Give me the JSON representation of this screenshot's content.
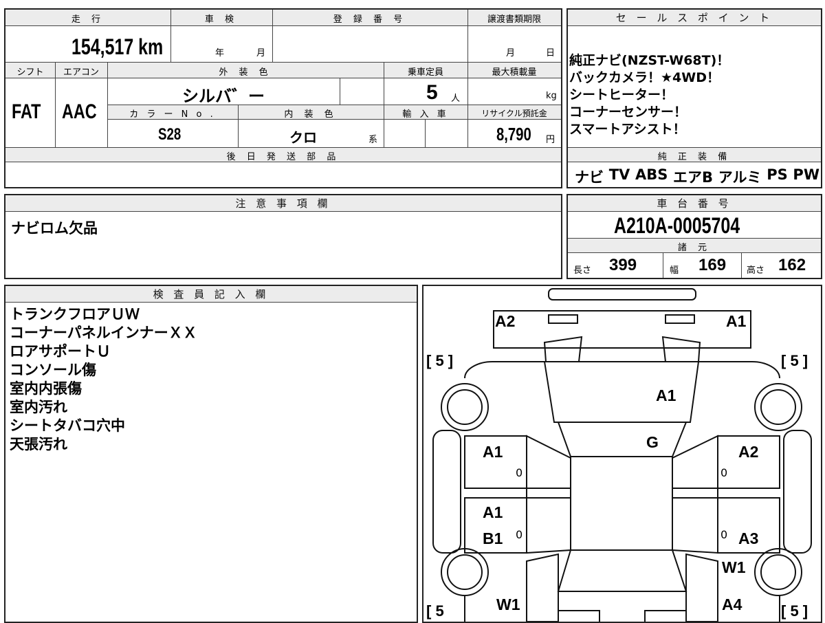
{
  "vehicle": {
    "mileage_header": "走 行",
    "mileage_value": "154,517",
    "mileage_unit": "km",
    "inspection_header": "車 検",
    "inspection_year": "年",
    "inspection_month": "月",
    "registration_header": "登 録 番 号",
    "transfer_deadline_header": "譲渡書類期限",
    "transfer_month": "月",
    "transfer_day": "日",
    "shift_header": "シフト",
    "shift_value": "FAT",
    "aircon_header": "エアコン",
    "aircon_value": "AAC",
    "exterior_color_header": "外 装 色",
    "exterior_color_value": "シルバ゛ー",
    "capacity_header": "乗車定員",
    "capacity_value": "5",
    "capacity_unit": "人",
    "max_load_header": "最大積載量",
    "max_load_unit": "kg",
    "color_no_header": "カ ラ ー N o .",
    "color_no_value": "S28",
    "interior_color_header": "内 装 色",
    "interior_color_value": "クロ",
    "interior_color_suffix": "系",
    "import_header": "輸 入 車",
    "recycle_header": "リサイクル預託金",
    "recycle_value": "8,790",
    "recycle_unit": "円",
    "later_parts_header": "後 日 発 送 部 品"
  },
  "sales_points": {
    "header": "セ ー ル ス ポ イ ン ト",
    "lines": [
      "純正ナビ(NZST-W68T)！",
      "バックカメラ！★4WD！",
      "シートヒーター！",
      "コーナーセンサー！",
      "スマートアシスト！"
    ]
  },
  "equipment": {
    "header": "純 正 装 備",
    "items": [
      "ナビ",
      "TV",
      "ABS",
      "エアB",
      "アルミ",
      "PS",
      "PW"
    ]
  },
  "notes": {
    "header": "注 意 事 項 欄",
    "text": "ナビロム欠品"
  },
  "chassis": {
    "header": "車 台 番 号",
    "value": "A210A-0005704"
  },
  "specs": {
    "header": "諸 元",
    "length_label": "長さ",
    "length_value": "399",
    "width_label": "幅",
    "width_value": "169",
    "height_label": "高さ",
    "height_value": "162"
  },
  "inspector": {
    "header": "検 査 員 記 入 欄",
    "lines": [
      "トランクフロアＵＷ",
      "コーナーパネルインナーＸＸ",
      "ロアサポートＵ",
      "コンソール傷",
      "室内内張傷",
      "室内汚れ",
      "シートタバコ穴中",
      "天張汚れ"
    ]
  },
  "diagram": {
    "tire_top_left": "[ 5 ]",
    "tire_top_right": "[ 5 ]",
    "tire_bottom_left": "[ 5",
    "tire_bottom_right": "[ 5 ]",
    "grades": {
      "rear_left": "A2",
      "rear_right": "A1",
      "trunk": "A1",
      "roof": "G",
      "left_rear_door": "A1",
      "left_front_door": "A1",
      "left_sill": "B1",
      "left_front_fender": "W1",
      "right_rear_door": "A2",
      "right_sill": "A3",
      "right_front_door": "W1",
      "right_front_fender": "A4"
    },
    "small_marks": [
      "0",
      "0",
      "0",
      "0"
    ]
  }
}
